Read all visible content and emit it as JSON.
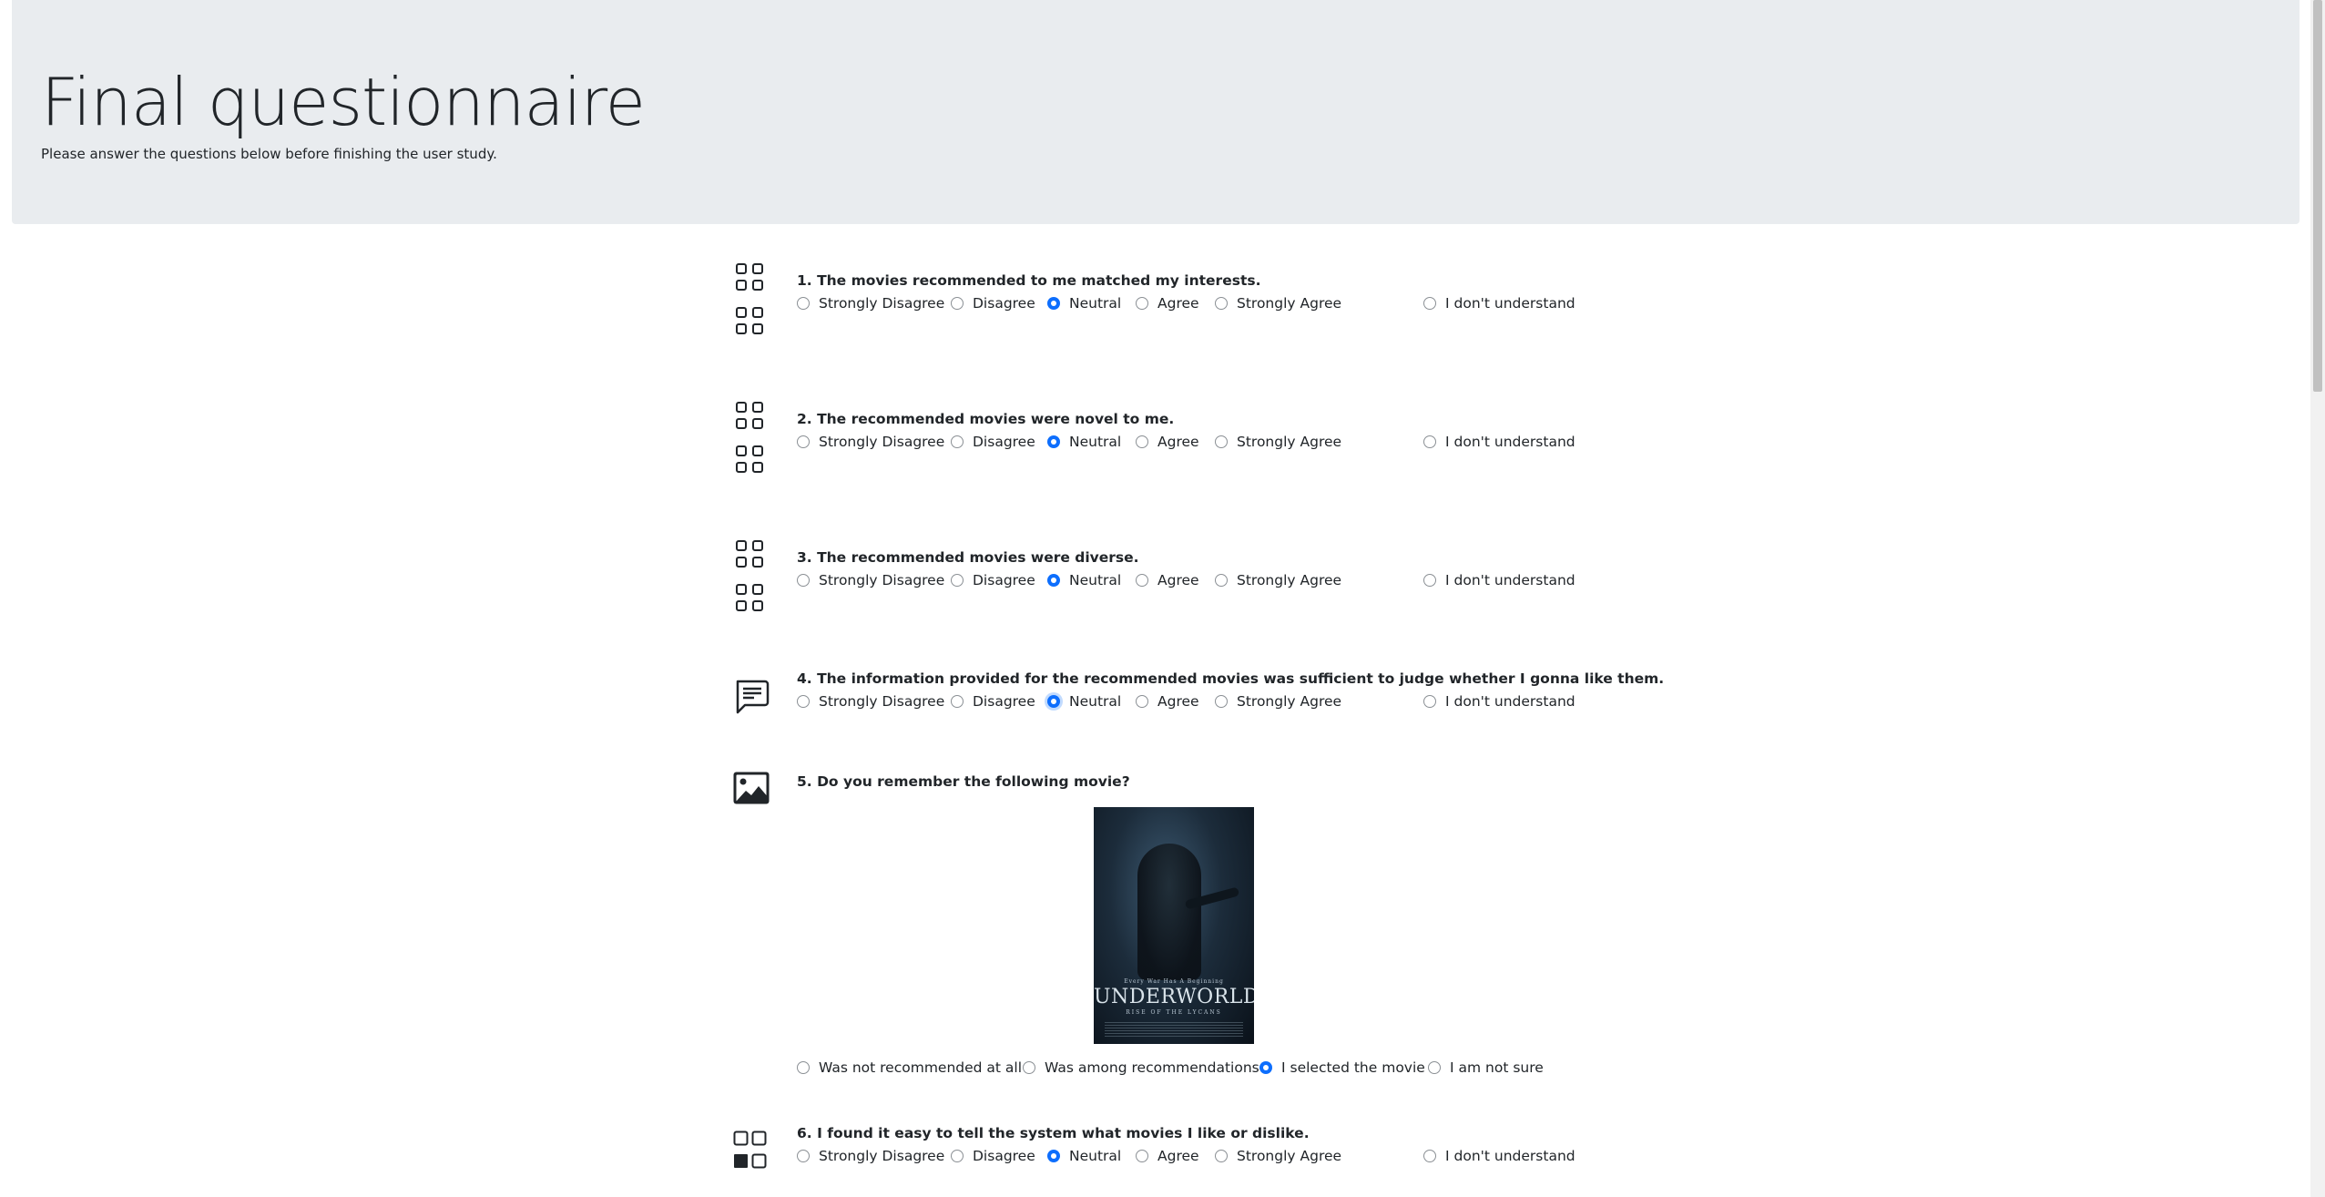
{
  "header": {
    "title": "Final questionnaire",
    "subtitle": "Please answer the questions below before finishing the user study."
  },
  "likert_options": [
    "Strongly Disagree",
    "Disagree",
    "Neutral",
    "Agree",
    "Strongly Agree"
  ],
  "dont_understand_label": "I don't understand",
  "questions": [
    {
      "title": "1. The movies recommended to me matched my interests.",
      "icon": "grid-icon",
      "selected": "Neutral"
    },
    {
      "title": "2. The recommended movies were novel to me.",
      "icon": "grid-icon",
      "selected": "Neutral"
    },
    {
      "title": "3. The recommended movies were diverse.",
      "icon": "grid-icon",
      "selected": "Neutral"
    },
    {
      "title": "4. The information provided for the recommended movies was sufficient to judge whether I gonna like them.",
      "icon": "chat-text-icon",
      "selected": "Neutral"
    },
    {
      "title": "5. Do you remember the following movie?",
      "icon": "image-icon",
      "poster": {
        "tagline": "Every War Has A Beginning",
        "title": "UNDERWORLD",
        "subtitle": "RISE OF THE LYCANS"
      },
      "options": [
        "Was not recommended at all",
        "Was among recommendations",
        "I selected the movie",
        "I am not sure"
      ],
      "selected": "I selected the movie"
    },
    {
      "title": "6. I found it easy to tell the system what movies I like or dislike.",
      "icon": "ui-checks-grid-icon",
      "selected": "Neutral"
    }
  ],
  "colors": {
    "accent": "#0d6efd",
    "header_bg": "#e9ecef",
    "text": "#212529"
  }
}
